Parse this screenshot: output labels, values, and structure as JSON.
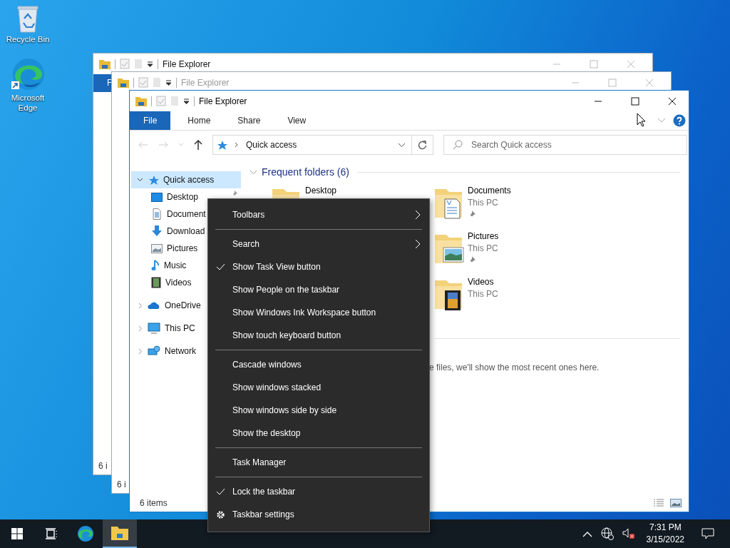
{
  "desktop_icons": [
    {
      "label": "Recycle Bin",
      "kind": "recycle"
    },
    {
      "label": "Microsoft Edge",
      "kind": "edge"
    }
  ],
  "back_windows": [
    {
      "title": "File Explorer",
      "inactive": false,
      "ribbon_tab": "F",
      "status": "6 i"
    },
    {
      "title": "File Explorer",
      "inactive": true,
      "status": "6 i"
    }
  ],
  "explorer": {
    "title": "File Explorer",
    "ribbon_tabs": [
      {
        "label": "File",
        "selected": true
      },
      {
        "label": "Home",
        "selected": false
      },
      {
        "label": "Share",
        "selected": false
      },
      {
        "label": "View",
        "selected": false
      }
    ],
    "address": "Quick access",
    "search": {
      "placeholder": "Search Quick access"
    },
    "nav": [
      {
        "label": "Quick access",
        "kind": "quickaccess",
        "selected": true,
        "expanded": true,
        "children": [
          {
            "label": "Desktop",
            "kind": "desktop",
            "selected": false,
            "pinned": true
          },
          {
            "label": "Document",
            "kind": "documents",
            "selected": false
          },
          {
            "label": "Download",
            "kind": "downloads",
            "selected": false
          },
          {
            "label": "Pictures",
            "kind": "pictures",
            "selected": false
          },
          {
            "label": "Music",
            "kind": "music",
            "selected": false
          },
          {
            "label": "Videos",
            "kind": "videos",
            "selected": false
          }
        ]
      },
      {
        "label": "OneDrive",
        "kind": "onedrive",
        "selected": false,
        "expanded": false
      },
      {
        "label": "This PC",
        "kind": "thispc",
        "selected": false,
        "expanded": false
      },
      {
        "label": "Network",
        "kind": "network",
        "selected": false,
        "expanded": false
      }
    ],
    "section_title": "Frequent folders (6)",
    "folders": [
      {
        "name": "Desktop",
        "kind": "desktop"
      },
      {
        "name": "Documents",
        "location": "This PC",
        "pinned": true,
        "kind": "documents"
      },
      {
        "name": "Pictures",
        "location": "This PC",
        "pinned": true,
        "kind": "pictures"
      },
      {
        "name": "Videos",
        "location": "This PC",
        "kind": "videos"
      }
    ],
    "recent_note": "e files, we'll show the most recent ones here.",
    "status": "6 items"
  },
  "context_menu": {
    "groups": [
      [
        {
          "label": "Toolbars",
          "kind": "item",
          "checked": false,
          "submenu": true
        }
      ],
      [
        {
          "label": "Search",
          "kind": "item",
          "checked": false,
          "submenu": true
        },
        {
          "label": "Show Task View button",
          "kind": "item",
          "checked": true,
          "submenu": false
        },
        {
          "label": "Show People on the taskbar",
          "kind": "item",
          "checked": false,
          "submenu": false
        },
        {
          "label": "Show Windows Ink Workspace button",
          "kind": "item",
          "checked": false,
          "submenu": false
        },
        {
          "label": "Show touch keyboard button",
          "kind": "item",
          "checked": false,
          "submenu": false
        }
      ],
      [
        {
          "label": "Cascade windows",
          "kind": "item",
          "checked": false,
          "submenu": false
        },
        {
          "label": "Show windows stacked",
          "kind": "item",
          "checked": false,
          "submenu": false
        },
        {
          "label": "Show windows side by side",
          "kind": "item",
          "checked": false,
          "submenu": false
        },
        {
          "label": "Show the desktop",
          "kind": "item",
          "checked": false,
          "submenu": false
        }
      ],
      [
        {
          "label": "Task Manager",
          "kind": "item",
          "checked": false,
          "submenu": false
        }
      ],
      [
        {
          "label": "Lock the taskbar",
          "kind": "item",
          "checked": true,
          "submenu": false
        },
        {
          "label": "Taskbar settings",
          "kind": "settings",
          "checked": false,
          "submenu": false
        }
      ]
    ]
  },
  "taskbar": {
    "apps": [
      {
        "kind": "taskview",
        "active": false
      },
      {
        "kind": "edge",
        "active": false
      },
      {
        "kind": "explorer",
        "active": true
      }
    ],
    "time": "7:31 PM",
    "date": "3/15/2022"
  }
}
